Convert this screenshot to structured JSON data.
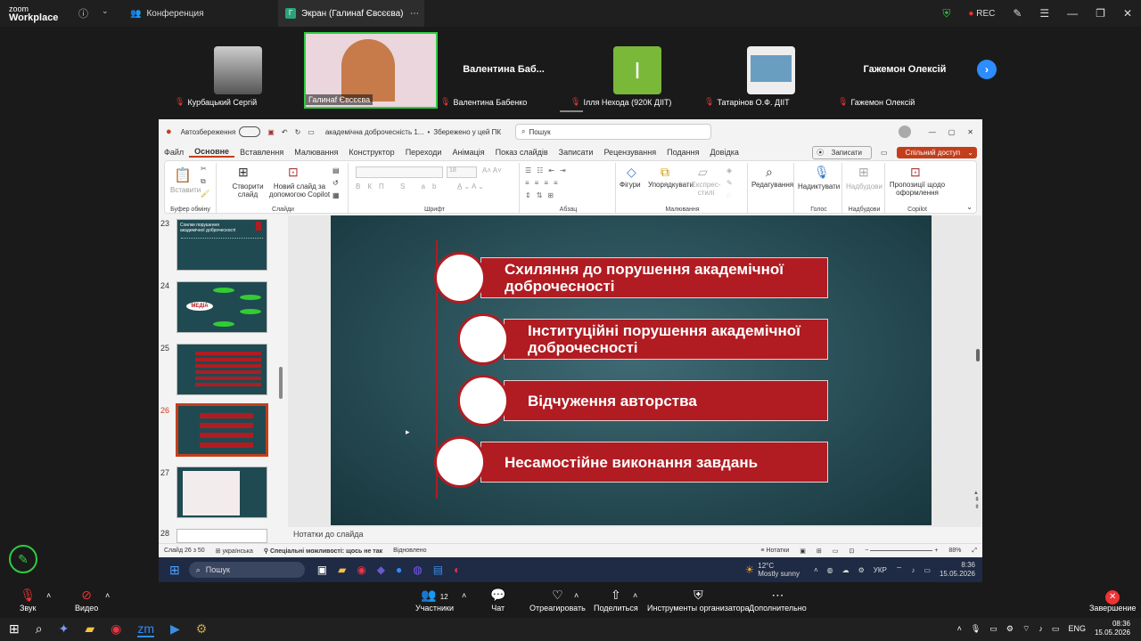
{
  "zoom": {
    "logo_top": "zoom",
    "logo_bottom": "Workplace",
    "tab_conference": "Конференция",
    "tab_screen": "Экран (Галинаf Євсєєва)",
    "tab_screen_initial": "Г",
    "rec": "REC"
  },
  "participants": [
    {
      "name": "Курбацький Сергій",
      "type": "photo"
    },
    {
      "name": "Галинаf Євсєєва",
      "type": "video"
    },
    {
      "name": "Валентина Бабенко",
      "display": "Валентина Баб...",
      "type": "name"
    },
    {
      "name": "Ілля Неходa (920К ДІІТ)",
      "initial": "І",
      "type": "initial"
    },
    {
      "name": "Татарінов О.Ф. ДІІТ",
      "type": "photo"
    },
    {
      "name": "Гажемон Олексій",
      "display": "Гажемон Олексій",
      "type": "name"
    }
  ],
  "ppt": {
    "autosave": "Автозбереження",
    "filename": "академічна доброчесність 1...",
    "saved": "Збережено у цей ПК",
    "search": "Пошук",
    "record": "Записати",
    "share": "Спільний доступ",
    "menu": [
      "Файл",
      "Основне",
      "Вставлення",
      "Малювання",
      "Конструктор",
      "Переходи",
      "Анімація",
      "Показ слайдів",
      "Записати",
      "Рецензування",
      "Подання",
      "Довідка"
    ],
    "ribbon": {
      "paste": "Вставити",
      "clipboard": "Буфер обміну",
      "create_slide": "Створити слайд",
      "new_slide_copilot": "Новий слайд за допомогою Copilot",
      "slides": "Слайди",
      "font_size": "18",
      "font": "Шрифт",
      "paragraph": "Абзац",
      "shapes": "Фігури",
      "arrange": "Упорядкувати",
      "express": "Експрес-стилі",
      "drawing": "Малювання",
      "editing": "Редагування",
      "dictate": "Надиктувати",
      "voice": "Голос",
      "add": "Надбудови",
      "addins": "Надбудови",
      "designer": "Пропозиції щодо оформлення",
      "copilot": "Copilot"
    },
    "thumb_numbers": [
      "23",
      "24",
      "25",
      "26",
      "27",
      "28"
    ],
    "thumb23_title": "Схилки порушення академічної доброчесності",
    "thumb24_label": "МЕДІА",
    "slide_items": [
      "Схиляння до порушення академічної доброчесності",
      "Інституційні порушення академічної доброчесності",
      "Відчуження авторства",
      "Несамостійне виконання завдань"
    ],
    "notes": "Нотатки до слайда",
    "status": {
      "slide": "Слайд 26 з 50",
      "lang": "українська",
      "access": "Спеціальні можливості: щось не так",
      "restored": "Відновлено",
      "notes": "Нотатки",
      "zoom": "88%"
    }
  },
  "inner_taskbar": {
    "search": "Пошук",
    "temp": "12°C",
    "weather": "Mostly sunny",
    "lang": "УКР",
    "time": "8:36",
    "date": "15.05.2026"
  },
  "zoom_toolbar": {
    "audio": "Звук",
    "video": "Видео",
    "participants": "Участники",
    "participants_count": "12",
    "chat": "Чат",
    "react": "Отреагировать",
    "share": "Поделиться",
    "host_tools": "Инструменты организатора",
    "more": "Дополнительно",
    "end": "Завершение"
  },
  "outer_taskbar": {
    "lang": "ENG",
    "time": "08:36",
    "date": "15.05.2026"
  }
}
